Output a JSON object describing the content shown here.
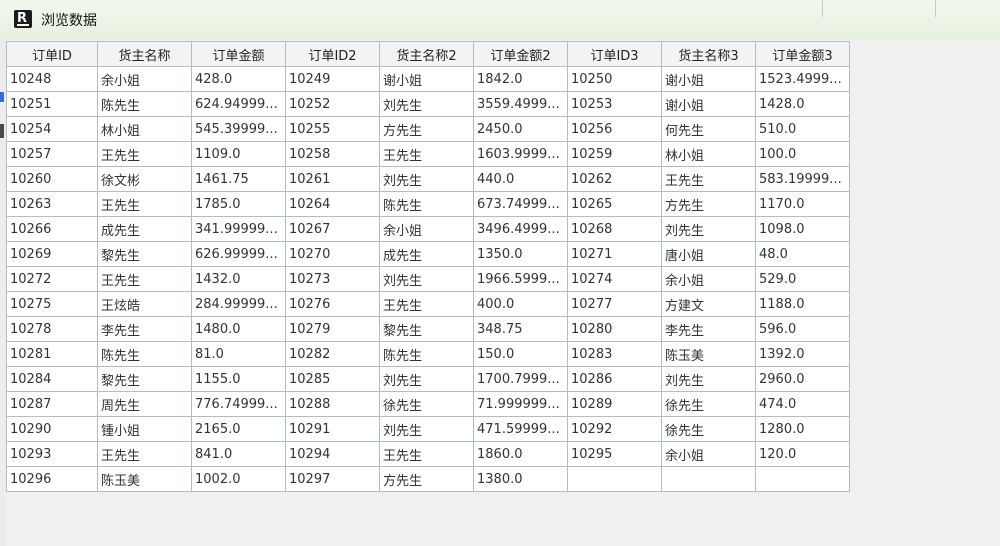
{
  "window": {
    "title": "浏览数据",
    "icon": "app-logo-icon"
  },
  "table": {
    "columns": [
      "订单ID",
      "货主名称",
      "订单金额",
      "订单ID2",
      "货主名称2",
      "订单金额2",
      "订单ID3",
      "货主名称3",
      "订单金额3"
    ],
    "rows": [
      [
        "10248",
        "余小姐",
        "428.0",
        "10249",
        "谢小姐",
        "1842.0",
        "10250",
        "谢小姐",
        "1523.4999..."
      ],
      [
        "10251",
        "陈先生",
        "624.94999...",
        "10252",
        "刘先生",
        "3559.4999...",
        "10253",
        "谢小姐",
        "1428.0"
      ],
      [
        "10254",
        "林小姐",
        "545.39999...",
        "10255",
        "方先生",
        "2450.0",
        "10256",
        "何先生",
        "510.0"
      ],
      [
        "10257",
        "王先生",
        "1109.0",
        "10258",
        "王先生",
        "1603.9999...",
        "10259",
        "林小姐",
        "100.0"
      ],
      [
        "10260",
        "徐文彬",
        "1461.75",
        "10261",
        "刘先生",
        "440.0",
        "10262",
        "王先生",
        "583.19999..."
      ],
      [
        "10263",
        "王先生",
        "1785.0",
        "10264",
        "陈先生",
        "673.74999...",
        "10265",
        "方先生",
        "1170.0"
      ],
      [
        "10266",
        "成先生",
        "341.99999...",
        "10267",
        "余小姐",
        "3496.4999...",
        "10268",
        "刘先生",
        "1098.0"
      ],
      [
        "10269",
        "黎先生",
        "626.99999...",
        "10270",
        "成先生",
        "1350.0",
        "10271",
        "唐小姐",
        "48.0"
      ],
      [
        "10272",
        "王先生",
        "1432.0",
        "10273",
        "刘先生",
        "1966.5999...",
        "10274",
        "余小姐",
        "529.0"
      ],
      [
        "10275",
        "王炫皓",
        "284.99999...",
        "10276",
        "王先生",
        "400.0",
        "10277",
        "方建文",
        "1188.0"
      ],
      [
        "10278",
        "李先生",
        "1480.0",
        "10279",
        "黎先生",
        "348.75",
        "10280",
        "李先生",
        "596.0"
      ],
      [
        "10281",
        "陈先生",
        "81.0",
        "10282",
        "陈先生",
        "150.0",
        "10283",
        "陈玉美",
        "1392.0"
      ],
      [
        "10284",
        "黎先生",
        "1155.0",
        "10285",
        "刘先生",
        "1700.7999...",
        "10286",
        "刘先生",
        "2960.0"
      ],
      [
        "10287",
        "周先生",
        "776.74999...",
        "10288",
        "徐先生",
        "71.999999...",
        "10289",
        "徐先生",
        "474.0"
      ],
      [
        "10290",
        "锺小姐",
        "2165.0",
        "10291",
        "刘先生",
        "471.59999...",
        "10292",
        "徐先生",
        "1280.0"
      ],
      [
        "10293",
        "王先生",
        "841.0",
        "10294",
        "王先生",
        "1860.0",
        "10295",
        "余小姐",
        "120.0"
      ],
      [
        "10296",
        "陈玉美",
        "1002.0",
        "10297",
        "方先生",
        "1380.0",
        "",
        "",
        ""
      ]
    ]
  }
}
